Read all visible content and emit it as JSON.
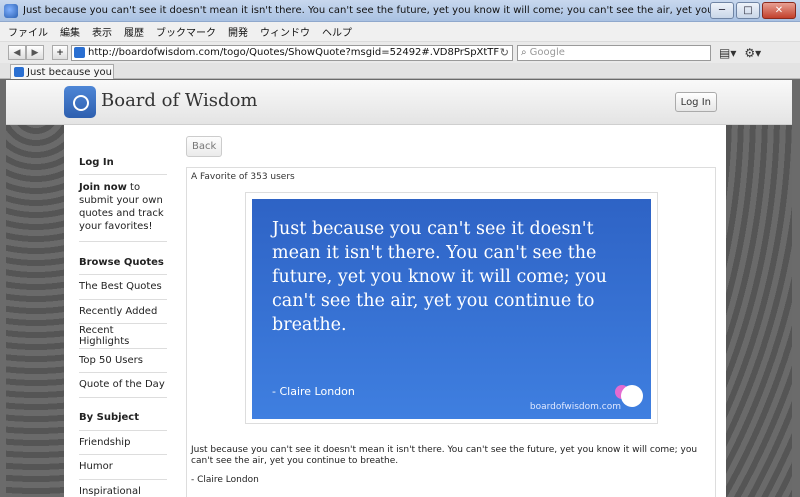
{
  "window": {
    "title": "Just because you can't see it doesn't mean it isn't there. You can't see the future, yet you know it will come; you can't see the air, yet you continue to breathe.",
    "minimize": "─",
    "maximize": "□",
    "close": "✕"
  },
  "menu": {
    "items": [
      "ファイル",
      "編集",
      "表示",
      "履歴",
      "ブックマーク",
      "開発",
      "ウィンドウ",
      "ヘルプ"
    ]
  },
  "nav": {
    "back": "◀",
    "forward": "▶",
    "new_tab": "+",
    "url": "http://boardofwisdom.com/togo/Quotes/ShowQuote?msgid=52492#.VD8PrSpXtTF",
    "reload": "↻",
    "search_placeholder": "Google",
    "search_icon": "🔍"
  },
  "tab": {
    "label": "Just because you ca"
  },
  "site": {
    "logo_text": "Board of Wisdom",
    "login_button": "Log In"
  },
  "sidebar": {
    "login_heading": "Log In",
    "join_bold": "Join now",
    "join_rest": " to submit your own quotes and track your favorites!",
    "browse_heading": "Browse Quotes",
    "browse_items": [
      "The Best Quotes",
      "Recently Added",
      "Recent Highlights",
      "Top 50 Users",
      "Quote of the Day"
    ],
    "subject_heading": "By Subject",
    "subject_items": [
      "Friendship",
      "Humor",
      "Inspirational"
    ]
  },
  "main": {
    "back_button": "Back",
    "favorite_count": "A Favorite of 353 users",
    "quote_image_text": "Just because you can't see it doesn't mean it isn't there. You can't see the future, yet you know it will come; you can't see the air, yet you continue to breathe.",
    "quote_image_author": "- Claire London",
    "quote_image_site": "boardofwisdom.com",
    "quote_text": "Just because you can't see it doesn't mean it isn't there. You can't see the future, yet you know it will come; you can't see the air, yet you continue to breathe.",
    "quote_author": "- Claire London"
  }
}
